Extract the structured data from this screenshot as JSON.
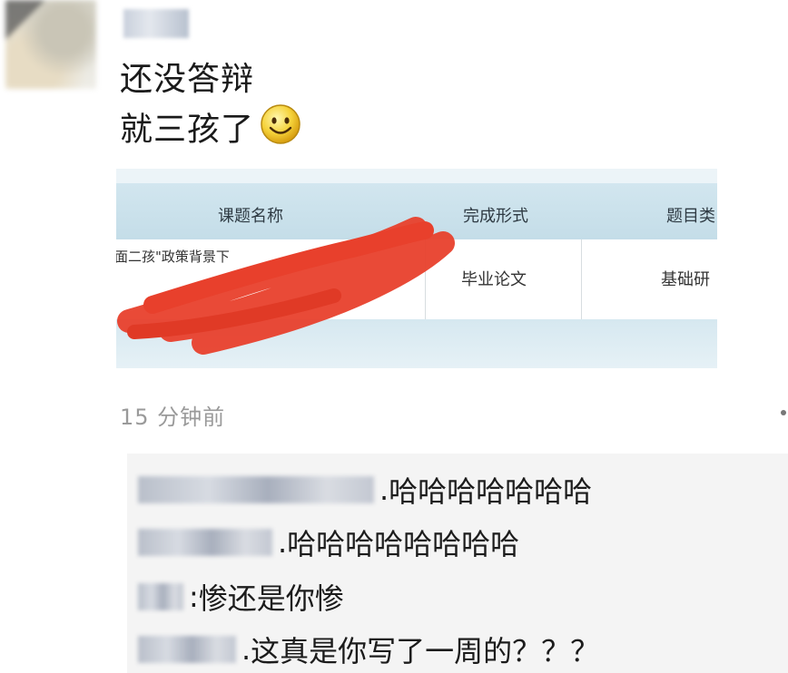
{
  "post": {
    "text_line1": "还没答辩",
    "text_line2": "就三孩了",
    "emoji": "smiley-face-icon",
    "timestamp": "15 分钟前"
  },
  "attachment_table": {
    "headers": [
      "课题名称",
      "完成形式",
      "题目类"
    ],
    "row": {
      "title_visible": "面二孩\"政策背景下",
      "completion_form": "毕业论文",
      "topic_type": "基础研"
    },
    "redaction_color": "#e8402c"
  },
  "comments": [
    {
      "separator": ".",
      "text": "哈哈哈哈哈哈哈"
    },
    {
      "separator": ".",
      "text": "哈哈哈哈哈哈哈哈"
    },
    {
      "separator": ":",
      "text": "惨还是你惨"
    },
    {
      "separator": ".",
      "text": "这真是你写了一周的？？？"
    }
  ]
}
